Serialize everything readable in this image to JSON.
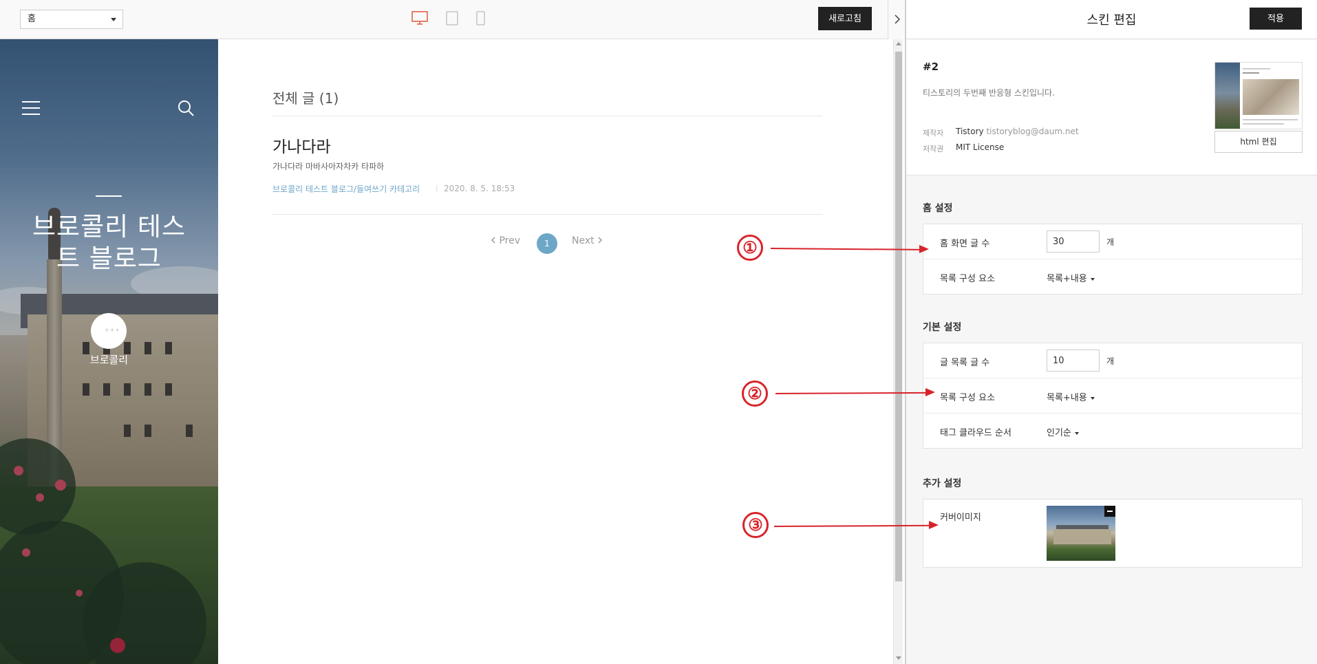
{
  "topbar": {
    "page_select": "홈",
    "refresh_label": "새로고침"
  },
  "colors": {
    "accent": "#6ea6c8",
    "dark_button": "#222222",
    "annotation": "#d8232a",
    "device_active": "#e0583a"
  },
  "blog": {
    "title": "브로콜리 테스트 블로그",
    "nickname": "브로콜리",
    "avatar_placeholder": "+++",
    "icons": [
      "menu-icon",
      "search-icon",
      "pencil-icon",
      "notebook-icon",
      "rss-icon",
      "gear-icon"
    ]
  },
  "posts": {
    "list_title": "전체 글 (1)",
    "items": [
      {
        "title": "가나다라",
        "summary": "가나다라 마바사아자차카 타파하",
        "category": "브로콜리 테스트 블로그/들여쓰기 카테고리",
        "date": "2020. 8. 5. 18:53"
      }
    ],
    "pagination": {
      "prev": "Prev",
      "current": "1",
      "next": "Next"
    }
  },
  "panel": {
    "title": "스킨 편집",
    "apply_label": "적용",
    "skin": {
      "number": "#2",
      "description": "티스토리의 두번째 반응형 스킨입니다.",
      "author_label": "제작자",
      "author_name": "Tistory",
      "author_email": "tistoryblog@daum.net",
      "license_label": "저작권",
      "license_value": "MIT License",
      "html_edit_label": "html 편집"
    },
    "home_settings": {
      "title": "홈 설정",
      "post_count_label": "홈 화면 글 수",
      "post_count_value": "30",
      "unit": "개",
      "list_elem_label": "목록 구성 요소",
      "list_elem_value": "목록+내용"
    },
    "basic_settings": {
      "title": "기본 설정",
      "post_count_label": "글 목록 글 수",
      "post_count_value": "10",
      "unit": "개",
      "list_elem_label": "목록 구성 요소",
      "list_elem_value": "목록+내용",
      "tag_order_label": "태그 클라우드 순서",
      "tag_order_value": "인기순"
    },
    "extra_settings": {
      "title": "추가 설정",
      "cover_label": "커버이미지"
    }
  },
  "annotations": [
    "①",
    "②",
    "③"
  ]
}
